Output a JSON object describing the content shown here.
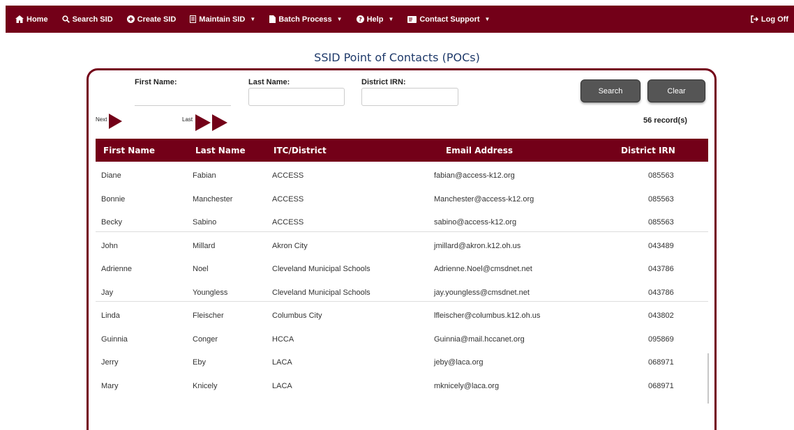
{
  "nav": {
    "home": "Home",
    "search_sid": "Search SID",
    "create_sid": "Create SID",
    "maintain_sid": "Maintain SID",
    "batch_process": "Batch Process",
    "help": "Help",
    "contact_support": "Contact Support",
    "log_off": "Log Off"
  },
  "page_title": "SSID Point of Contacts (POCs)",
  "search": {
    "first_name_label": "First Name:",
    "last_name_label": "Last Name:",
    "district_irn_label": "District IRN:",
    "first_name_value": "",
    "last_name_value": "",
    "district_irn_value": "",
    "search_button": "Search",
    "clear_button": "Clear"
  },
  "pager": {
    "next_label": "Next",
    "last_label": "Last",
    "records": "56 record(s)"
  },
  "table": {
    "headers": [
      "First Name",
      "Last Name",
      "ITC/District",
      "Email Address",
      "District IRN"
    ],
    "rows": [
      [
        "Diane",
        "Fabian",
        "ACCESS",
        "fabian@access-k12.org",
        "085563"
      ],
      [
        "Bonnie",
        "Manchester",
        "ACCESS",
        "Manchester@access-k12.org",
        "085563"
      ],
      [
        "Becky",
        "Sabino",
        "ACCESS",
        "sabino@access-k12.org",
        "085563"
      ],
      [
        "John",
        "Millard",
        "Akron City",
        "jmillard@akron.k12.oh.us",
        "043489"
      ],
      [
        "Adrienne",
        "Noel",
        "Cleveland Municipal Schools",
        "Adrienne.Noel@cmsdnet.net",
        "043786"
      ],
      [
        "Jay",
        "Youngless",
        "Cleveland Municipal Schools",
        "jay.youngless@cmsdnet.net",
        "043786"
      ],
      [
        "Linda",
        "Fleischer",
        "Columbus City",
        "lfleischer@columbus.k12.oh.us",
        "043802"
      ],
      [
        "Guinnia",
        "Conger",
        "HCCA",
        "Guinnia@mail.hccanet.org",
        "095869"
      ],
      [
        "Jerry",
        "Eby",
        "LACA",
        "jeby@laca.org",
        "068971"
      ],
      [
        "Mary",
        "Knicely",
        "LACA",
        "mknicely@laca.org",
        "068971"
      ]
    ]
  },
  "colors": {
    "brand": "#730018",
    "title": "#1f3a6a",
    "button": "#555555"
  }
}
